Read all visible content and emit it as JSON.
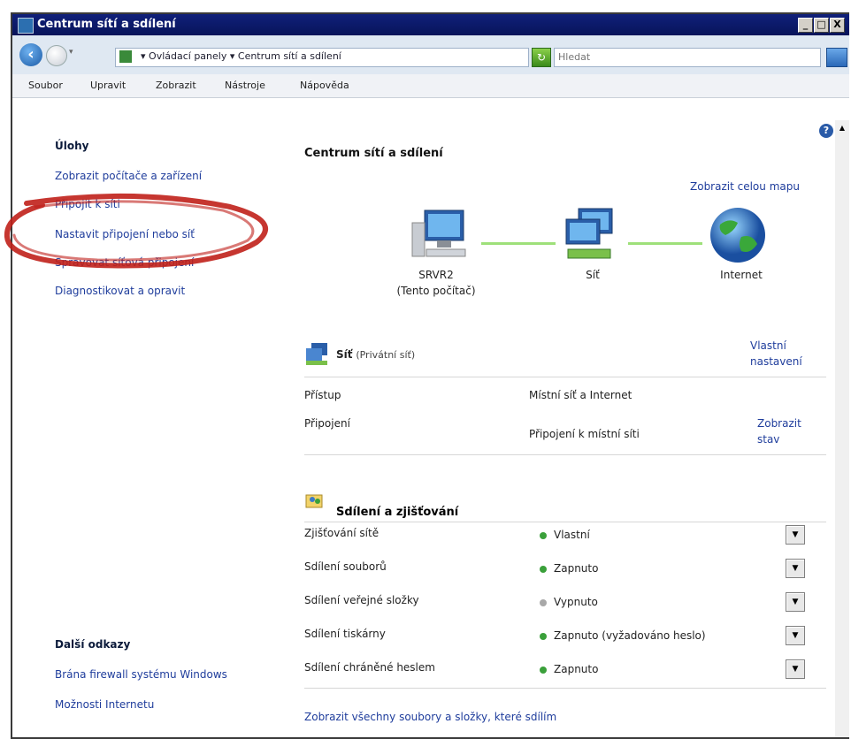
{
  "window": {
    "title": "Centrum sítí a sdílení",
    "btn_min": "_",
    "btn_max": "□",
    "btn_close": "X"
  },
  "address": {
    "crumb_sep": "▾",
    "crumb1": "Ovládací panely",
    "crumb2": "Centrum sítí a sdílení",
    "dropdown": "▾",
    "search_placeholder": "Hledat"
  },
  "menu": [
    "Soubor",
    "Upravit",
    "Zobrazit",
    "Nástroje",
    "Nápověda"
  ],
  "help_label": "?",
  "tasks": {
    "heading": "Úlohy",
    "items": [
      "Zobrazit počítače a zařízení",
      "Připojit k síti",
      "Nastavit připojení nebo síť",
      "Spravovat síťová připojení",
      "Diagnostikovat a opravit"
    ]
  },
  "other_links": {
    "heading": "Další odkazy",
    "items": [
      "Brána firewall systému Windows",
      "Možnosti Internetu"
    ]
  },
  "main": {
    "title": "Centrum sítí a sdílení",
    "map_link": "Zobrazit celou mapu",
    "nodes": {
      "computer_name": "SRVR2",
      "computer_sub": "(Tento počítač)",
      "network": "Síť",
      "internet": "Internet"
    }
  },
  "network": {
    "name": "Síť",
    "type": "(Privátní síť)",
    "customize_line1": "Vlastní",
    "customize_line2": "nastavení",
    "access_label": "Přístup",
    "access_value": "Místní síť a Internet",
    "connection_label": "Připojení",
    "connection_value": "Připojení k místní síti",
    "status_line1": "Zobrazit",
    "status_line2": "stav"
  },
  "sharing": {
    "title": "Sdílení a zjišťování",
    "rows": [
      {
        "label": "Zjišťování sítě",
        "value": "Vlastní",
        "on": true
      },
      {
        "label": "Sdílení souborů",
        "value": "Zapnuto",
        "on": true
      },
      {
        "label": "Sdílení veřejné složky",
        "value": "Vypnuto",
        "on": false
      },
      {
        "label": "Sdílení tiskárny",
        "value": "Zapnuto (vyžadováno heslo)",
        "on": true
      },
      {
        "label": "Sdílení chráněné heslem",
        "value": "Zapnuto",
        "on": true
      }
    ],
    "footer_link": "Zobrazit všechny soubory a složky, které sdílím"
  },
  "colors": {
    "title_bar": "#0a1a6a",
    "link": "#1f3d9c",
    "status_on": "#3aa03a",
    "status_off": "#a8a8a8",
    "annotation": "#c0201a"
  }
}
